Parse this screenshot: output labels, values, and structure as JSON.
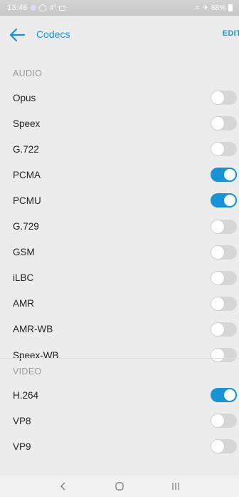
{
  "status_bar": {
    "time": "13:48",
    "temperature": "4°",
    "battery": "88%"
  },
  "app_bar": {
    "title": "Codecs",
    "edit_label": "EDIT",
    "accent_color": "#1a93d4"
  },
  "sections": {
    "audio": {
      "header": "AUDIO",
      "items": [
        {
          "label": "Opus",
          "enabled": false
        },
        {
          "label": "Speex",
          "enabled": false
        },
        {
          "label": "G.722",
          "enabled": false
        },
        {
          "label": "PCMA",
          "enabled": true
        },
        {
          "label": "PCMU",
          "enabled": true
        },
        {
          "label": "G.729",
          "enabled": false
        },
        {
          "label": "GSM",
          "enabled": false
        },
        {
          "label": "iLBC",
          "enabled": false
        },
        {
          "label": "AMR",
          "enabled": false
        },
        {
          "label": "AMR-WB",
          "enabled": false
        },
        {
          "label": "Speex-WB",
          "enabled": false
        }
      ]
    },
    "video": {
      "header": "VIDEO",
      "items": [
        {
          "label": "H.264",
          "enabled": true
        },
        {
          "label": "VP8",
          "enabled": false
        },
        {
          "label": "VP9",
          "enabled": false
        }
      ]
    }
  },
  "nav_bar": {
    "buttons": [
      "back-icon",
      "home-icon",
      "recents-icon"
    ]
  }
}
